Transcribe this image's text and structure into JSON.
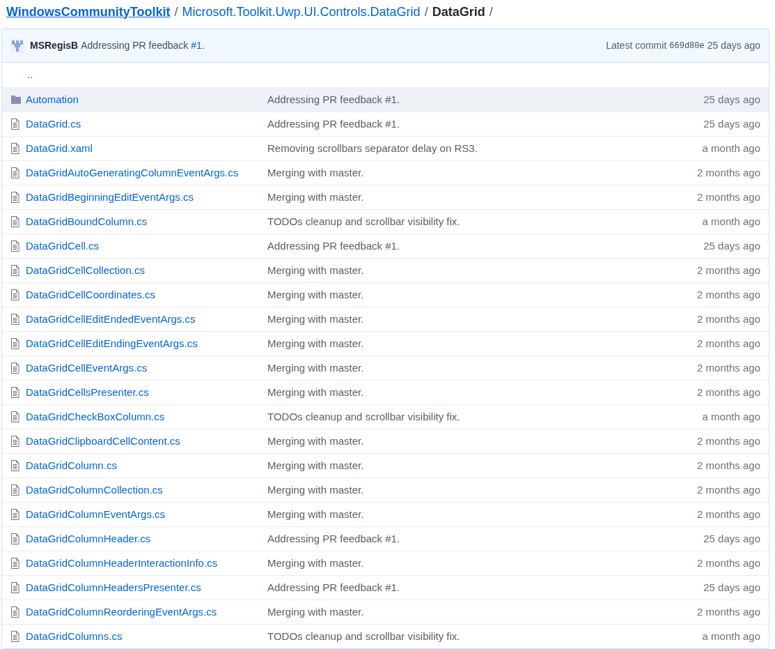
{
  "breadcrumb": [
    {
      "label": "WindowsCommunityToolkit",
      "kind": "root"
    },
    {
      "label": "/",
      "kind": "separator"
    },
    {
      "label": "Microsoft.Toolkit.Uwp.UI.Controls.DataGrid",
      "kind": "link"
    },
    {
      "label": "/",
      "kind": "separator"
    },
    {
      "label": "DataGrid",
      "kind": "current"
    },
    {
      "label": "/",
      "kind": "separator"
    }
  ],
  "commit": {
    "author": "MSRegisB",
    "message": "Addressing PR feedback",
    "issue_link": "#1",
    "message_end": ".",
    "latest_label": "Latest commit",
    "sha": "669d80e",
    "age": "25 days ago"
  },
  "parent_link": "..",
  "files": [
    {
      "kind": "folder",
      "name": "Automation",
      "message": "Addressing PR feedback #1.",
      "age": "25 days ago",
      "selected": true
    },
    {
      "kind": "file",
      "name": "DataGrid.cs",
      "message": "Addressing PR feedback #1.",
      "age": "25 days ago",
      "selected": false
    },
    {
      "kind": "file",
      "name": "DataGrid.xaml",
      "message": "Removing scrollbars separator delay on RS3.",
      "age": "a month ago",
      "selected": false
    },
    {
      "kind": "file",
      "name": "DataGridAutoGeneratingColumnEventArgs.cs",
      "message": "Merging with master.",
      "age": "2 months ago",
      "selected": false
    },
    {
      "kind": "file",
      "name": "DataGridBeginningEditEventArgs.cs",
      "message": "Merging with master.",
      "age": "2 months ago",
      "selected": false
    },
    {
      "kind": "file",
      "name": "DataGridBoundColumn.cs",
      "message": "TODOs cleanup and scrollbar visibility fix.",
      "age": "a month ago",
      "selected": false
    },
    {
      "kind": "file",
      "name": "DataGridCell.cs",
      "message": "Addressing PR feedback #1.",
      "age": "25 days ago",
      "selected": false
    },
    {
      "kind": "file",
      "name": "DataGridCellCollection.cs",
      "message": "Merging with master.",
      "age": "2 months ago",
      "selected": false
    },
    {
      "kind": "file",
      "name": "DataGridCellCoordinates.cs",
      "message": "Merging with master.",
      "age": "2 months ago",
      "selected": false
    },
    {
      "kind": "file",
      "name": "DataGridCellEditEndedEventArgs.cs",
      "message": "Merging with master.",
      "age": "2 months ago",
      "selected": false
    },
    {
      "kind": "file",
      "name": "DataGridCellEditEndingEventArgs.cs",
      "message": "Merging with master.",
      "age": "2 months ago",
      "selected": false
    },
    {
      "kind": "file",
      "name": "DataGridCellEventArgs.cs",
      "message": "Merging with master.",
      "age": "2 months ago",
      "selected": false
    },
    {
      "kind": "file",
      "name": "DataGridCellsPresenter.cs",
      "message": "Merging with master.",
      "age": "2 months ago",
      "selected": false
    },
    {
      "kind": "file",
      "name": "DataGridCheckBoxColumn.cs",
      "message": "TODOs cleanup and scrollbar visibility fix.",
      "age": "a month ago",
      "selected": false
    },
    {
      "kind": "file",
      "name": "DataGridClipboardCellContent.cs",
      "message": "Merging with master.",
      "age": "2 months ago",
      "selected": false
    },
    {
      "kind": "file",
      "name": "DataGridColumn.cs",
      "message": "Merging with master.",
      "age": "2 months ago",
      "selected": false
    },
    {
      "kind": "file",
      "name": "DataGridColumnCollection.cs",
      "message": "Merging with master.",
      "age": "2 months ago",
      "selected": false
    },
    {
      "kind": "file",
      "name": "DataGridColumnEventArgs.cs",
      "message": "Merging with master.",
      "age": "2 months ago",
      "selected": false
    },
    {
      "kind": "file",
      "name": "DataGridColumnHeader.cs",
      "message": "Addressing PR feedback #1.",
      "age": "25 days ago",
      "selected": false
    },
    {
      "kind": "file",
      "name": "DataGridColumnHeaderInteractionInfo.cs",
      "message": "Merging with master.",
      "age": "2 months ago",
      "selected": false
    },
    {
      "kind": "file",
      "name": "DataGridColumnHeadersPresenter.cs",
      "message": "Addressing PR feedback #1.",
      "age": "25 days ago",
      "selected": false
    },
    {
      "kind": "file",
      "name": "DataGridColumnReorderingEventArgs.cs",
      "message": "Merging with master.",
      "age": "2 months ago",
      "selected": false
    },
    {
      "kind": "file",
      "name": "DataGridColumns.cs",
      "message": "TODOs cleanup and scrollbar visibility fix.",
      "age": "a month ago",
      "selected": false
    }
  ]
}
